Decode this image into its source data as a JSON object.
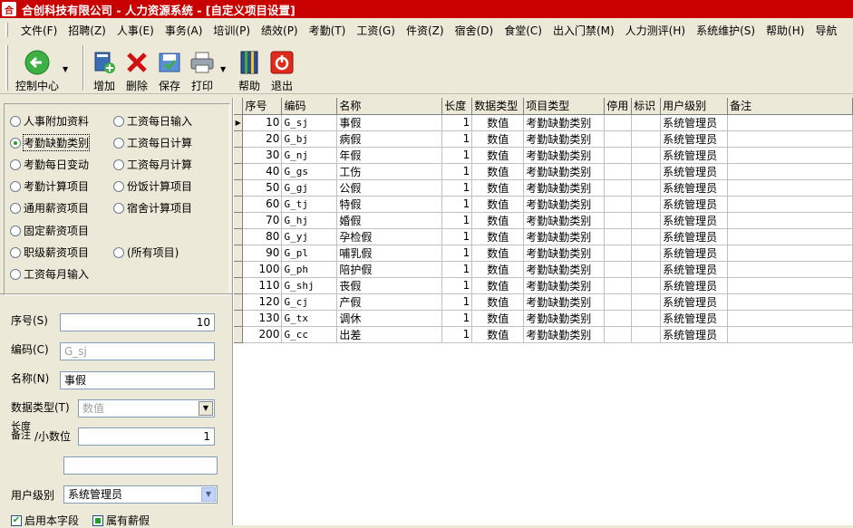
{
  "window": {
    "title": "合创科技有限公司 - 人力资源系统 - [自定义项目设置]",
    "icon_text": "合"
  },
  "menu": [
    "文件(F)",
    "招聘(Z)",
    "人事(E)",
    "事务(A)",
    "培训(P)",
    "绩效(P)",
    "考勤(T)",
    "工资(G)",
    "件资(Z)",
    "宿舍(D)",
    "食堂(C)",
    "出入门禁(M)",
    "人力测评(H)",
    "系统维护(S)",
    "帮助(H)",
    "导航"
  ],
  "toolbar": {
    "control_center": "控制中心",
    "add": "增加",
    "delete": "删除",
    "save": "保存",
    "print": "打印",
    "help": "帮助",
    "exit": "退出"
  },
  "categories": [
    {
      "label": "人事附加资料",
      "selected": false
    },
    {
      "label": "工资每日输入",
      "selected": false
    },
    {
      "label": "考勤缺勤类别",
      "selected": true
    },
    {
      "label": "工资每日计算",
      "selected": false
    },
    {
      "label": "考勤每日变动",
      "selected": false
    },
    {
      "label": "工资每月计算",
      "selected": false
    },
    {
      "label": "考勤计算项目",
      "selected": false
    },
    {
      "label": "份饭计算项目",
      "selected": false
    },
    {
      "label": "通用薪资项目",
      "selected": false
    },
    {
      "label": "宿舍计算项目",
      "selected": false
    },
    {
      "label": "固定薪资项目",
      "selected": false
    },
    {
      "label": "职级薪资项目",
      "selected": false
    },
    {
      "label": "(所有项目)",
      "selected": false
    },
    {
      "label": "工资每月输入",
      "selected": false
    }
  ],
  "form": {
    "seq_label": "序号(S)",
    "seq_value": "10",
    "code_label": "编码(C)",
    "code_value": "G_sj",
    "name_label": "名称(N)",
    "name_value": "事假",
    "datatype_label": "数据类型(T)",
    "datatype_value": "数值",
    "length_label_top": "长度",
    "length_label_bottom": "备注",
    "decimal_label": "/小数位",
    "decimal_value": "1",
    "remark_value": "",
    "user_level_label": "用户级别",
    "user_level_value": "系统管理员",
    "enable_field_label": "启用本字段",
    "enable_field_checked": true,
    "is_salary_label": "属有薪假",
    "is_salary_checked": "partial"
  },
  "grid": {
    "columns": [
      "序号",
      "编码",
      "名称",
      "长度",
      "数据类型",
      "项目类型",
      "停用",
      "标识",
      "用户级别",
      "备注"
    ],
    "current_row_marker": "▶",
    "rows": [
      {
        "seq": "10",
        "code": "G_sj",
        "name": "事假",
        "len": "1",
        "dtype": "数值",
        "ptype": "考勤缺勤类别",
        "stop": "",
        "flag": "",
        "level": "系统管理员",
        "remark": ""
      },
      {
        "seq": "20",
        "code": "G_bj",
        "name": "病假",
        "len": "1",
        "dtype": "数值",
        "ptype": "考勤缺勤类别",
        "stop": "",
        "flag": "",
        "level": "系统管理员",
        "remark": ""
      },
      {
        "seq": "30",
        "code": "G_nj",
        "name": "年假",
        "len": "1",
        "dtype": "数值",
        "ptype": "考勤缺勤类别",
        "stop": "",
        "flag": "",
        "level": "系统管理员",
        "remark": ""
      },
      {
        "seq": "40",
        "code": "G_gs",
        "name": "工伤",
        "len": "1",
        "dtype": "数值",
        "ptype": "考勤缺勤类别",
        "stop": "",
        "flag": "",
        "level": "系统管理员",
        "remark": ""
      },
      {
        "seq": "50",
        "code": "G_gj",
        "name": "公假",
        "len": "1",
        "dtype": "数值",
        "ptype": "考勤缺勤类别",
        "stop": "",
        "flag": "",
        "level": "系统管理员",
        "remark": ""
      },
      {
        "seq": "60",
        "code": "G_tj",
        "name": "特假",
        "len": "1",
        "dtype": "数值",
        "ptype": "考勤缺勤类别",
        "stop": "",
        "flag": "",
        "level": "系统管理员",
        "remark": ""
      },
      {
        "seq": "70",
        "code": "G_hj",
        "name": "婚假",
        "len": "1",
        "dtype": "数值",
        "ptype": "考勤缺勤类别",
        "stop": "",
        "flag": "",
        "level": "系统管理员",
        "remark": ""
      },
      {
        "seq": "80",
        "code": "G_yj",
        "name": "孕检假",
        "len": "1",
        "dtype": "数值",
        "ptype": "考勤缺勤类别",
        "stop": "",
        "flag": "",
        "level": "系统管理员",
        "remark": ""
      },
      {
        "seq": "90",
        "code": "G_pl",
        "name": "哺乳假",
        "len": "1",
        "dtype": "数值",
        "ptype": "考勤缺勤类别",
        "stop": "",
        "flag": "",
        "level": "系统管理员",
        "remark": ""
      },
      {
        "seq": "100",
        "code": "G_ph",
        "name": "陪护假",
        "len": "1",
        "dtype": "数值",
        "ptype": "考勤缺勤类别",
        "stop": "",
        "flag": "",
        "level": "系统管理员",
        "remark": ""
      },
      {
        "seq": "110",
        "code": "G_shj",
        "name": "丧假",
        "len": "1",
        "dtype": "数值",
        "ptype": "考勤缺勤类别",
        "stop": "",
        "flag": "",
        "level": "系统管理员",
        "remark": ""
      },
      {
        "seq": "120",
        "code": "G_cj",
        "name": "产假",
        "len": "1",
        "dtype": "数值",
        "ptype": "考勤缺勤类别",
        "stop": "",
        "flag": "",
        "level": "系统管理员",
        "remark": ""
      },
      {
        "seq": "130",
        "code": "G_tx",
        "name": "调休",
        "len": "1",
        "dtype": "数值",
        "ptype": "考勤缺勤类别",
        "stop": "",
        "flag": "",
        "level": "系统管理员",
        "remark": ""
      },
      {
        "seq": "200",
        "code": "G_cc",
        "name": "出差",
        "len": "1",
        "dtype": "数值",
        "ptype": "考勤缺勤类别",
        "stop": "",
        "flag": "",
        "level": "系统管理员",
        "remark": ""
      }
    ]
  }
}
